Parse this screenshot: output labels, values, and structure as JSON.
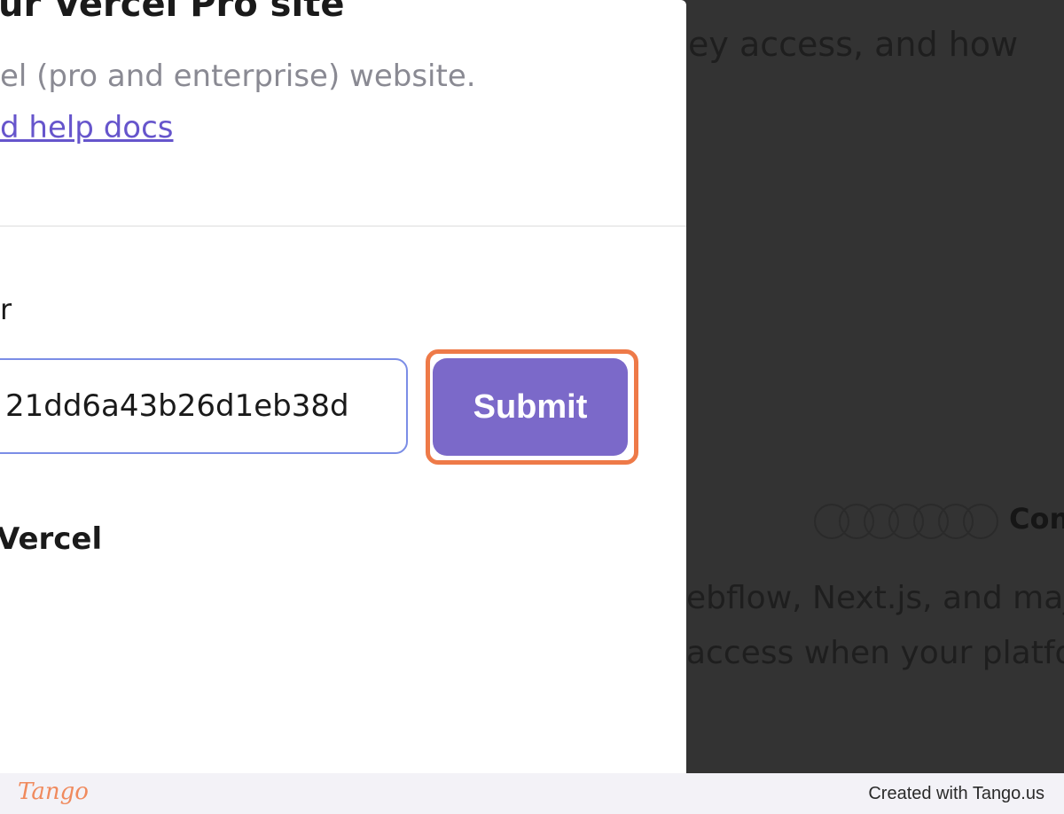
{
  "modal": {
    "title": "ur Vercel Pro site",
    "description": "el (pro and enterprise) website.",
    "help_link": "d help docs",
    "field_label": "r",
    "key_input_value": "21dd6a43b26d1eb38d",
    "submit_label": "Submit",
    "section_heading": "Vercel"
  },
  "background_page": {
    "line1": "ey access, and how",
    "line2": "ebflow, Next.js, and maj",
    "line3": "access when your platfo",
    "logos_label": "Con",
    "logo_icons": [
      "shopify-icon",
      "wix-icon",
      "puzzle-icon",
      "squarespace-icon",
      "google-icon",
      "dark-circle-icon",
      "google-cloud-icon"
    ]
  },
  "footer": {
    "logo": "Tango",
    "credit": "Created with Tango.us"
  },
  "colors": {
    "accent": "#7b69c9",
    "link": "#6655cc",
    "highlight": "#ee7a48",
    "input_border": "#7b8de6",
    "overlay": "#333333"
  }
}
